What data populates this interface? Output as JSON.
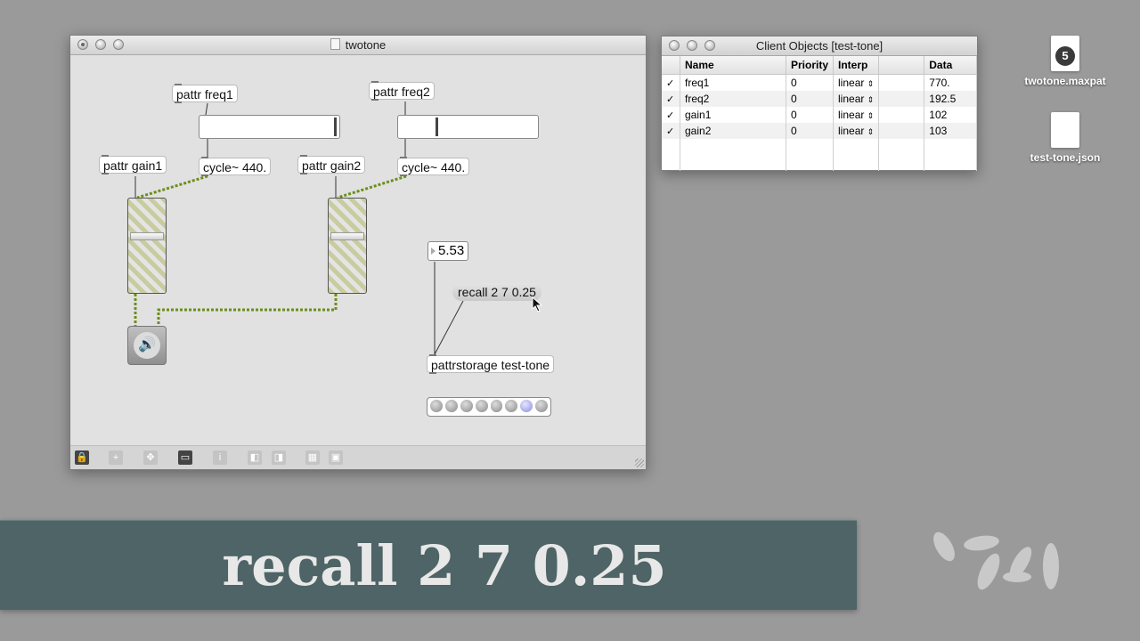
{
  "patcher_window": {
    "title": "twotone",
    "objects": {
      "pattr_freq1": "pattr freq1",
      "pattr_freq2": "pattr freq2",
      "pattr_gain1": "pattr gain1",
      "pattr_gain2": "pattr gain2",
      "cycle1": "cycle~ 440.",
      "cycle2": "cycle~ 440.",
      "number_value": "5.53",
      "recall_message": "recall 2 7 0.25",
      "pattrstorage": "pattrstorage test-tone"
    },
    "sliders": {
      "freq1_level": 0.98,
      "freq2_level": 0.25,
      "gain1_level": 0.62,
      "gain2_level": 0.62
    },
    "preset": {
      "count": 8,
      "active_index": 6
    },
    "toolbar_icons": [
      "lock-icon",
      "add-object-icon",
      "move-icon",
      "presentation-icon",
      "inspector-icon",
      "layer-back-icon",
      "layer-front-icon",
      "grid-icon",
      "snap-icon"
    ]
  },
  "client_window": {
    "title": "Client Objects [test-tone]",
    "columns": [
      "Name",
      "Priority",
      "Interp",
      "",
      "Data"
    ],
    "rows": [
      {
        "checked": "✓",
        "name": "freq1",
        "priority": "0",
        "interp": "linear",
        "data": "770."
      },
      {
        "checked": "✓",
        "name": "freq2",
        "priority": "0",
        "interp": "linear",
        "data": "192.5"
      },
      {
        "checked": "✓",
        "name": "gain1",
        "priority": "0",
        "interp": "linear",
        "data": "102"
      },
      {
        "checked": "✓",
        "name": "gain2",
        "priority": "0",
        "interp": "linear",
        "data": "103"
      }
    ]
  },
  "desktop": {
    "files": [
      {
        "name": "twotone.maxpat",
        "badge": "5"
      },
      {
        "name": "test-tone.json"
      }
    ]
  },
  "banner": {
    "text": "recall 2 7 0.25"
  },
  "colors": {
    "desktop": "#9a9a9a",
    "banner": "#4e6466",
    "patch_cord_signal": "#6b8f1a"
  }
}
